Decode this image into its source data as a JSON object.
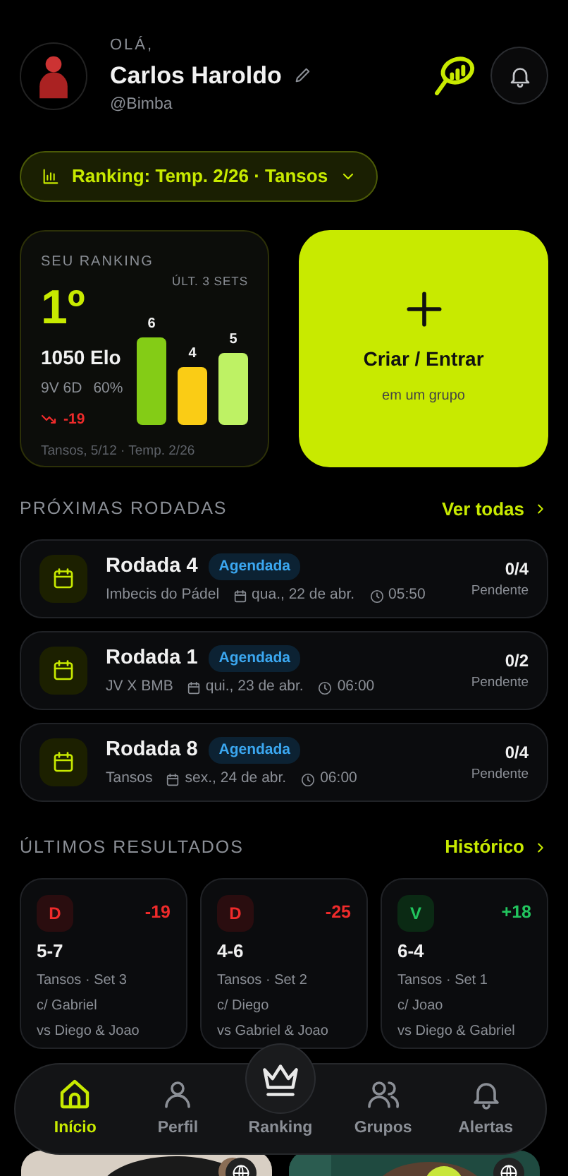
{
  "header": {
    "greeting": "OLÁ,",
    "name": "Carlos Haroldo",
    "handle": "@Bimba"
  },
  "ranking_filter": {
    "label": "Ranking: Temp. 2/26 · Tansos"
  },
  "ranking_card": {
    "title": "SEU RANKING",
    "sets_label": "ÚLT. 3 SETS",
    "position": "1º",
    "elo": "1050 Elo",
    "record": "9V 6D",
    "winrate": "60%",
    "trend": "-19",
    "footer": "Tansos, 5/12 · Temp. 2/26",
    "chart_data": {
      "type": "bar",
      "values": [
        6,
        4,
        5
      ],
      "colors": [
        "#84cc16",
        "#facc15",
        "#bef264"
      ],
      "data_labels": true
    }
  },
  "create_card": {
    "title": "Criar / Entrar",
    "subtitle": "em um grupo"
  },
  "upcoming": {
    "title": "PRÓXIMAS RODADAS",
    "link": "Ver todas",
    "rounds": [
      {
        "name": "Rodada 4",
        "status": "Agendada",
        "group": "Imbecis do Pádel",
        "date": "qua., 22 de abr.",
        "time": "05:50",
        "score": "0/4",
        "score_label": "Pendente"
      },
      {
        "name": "Rodada 1",
        "status": "Agendada",
        "group": "JV X BMB",
        "date": "qui., 23 de abr.",
        "time": "06:00",
        "score": "0/2",
        "score_label": "Pendente"
      },
      {
        "name": "Rodada 8",
        "status": "Agendada",
        "group": "Tansos",
        "date": "sex., 24 de abr.",
        "time": "06:00",
        "score": "0/4",
        "score_label": "Pendente"
      }
    ]
  },
  "results": {
    "title": "ÚLTIMOS RESULTADOS",
    "link": "Histórico",
    "items": [
      {
        "kind": "loss",
        "outcome": "D",
        "delta": "-19",
        "score": "5-7",
        "set": "Tansos · Set 3",
        "partner": "c/ Gabriel",
        "opponents": "vs Diego & Joao"
      },
      {
        "kind": "loss",
        "outcome": "D",
        "delta": "-25",
        "score": "4-6",
        "set": "Tansos · Set 2",
        "partner": "c/ Diego",
        "opponents": "vs Gabriel & Joao"
      },
      {
        "kind": "win",
        "outcome": "V",
        "delta": "+18",
        "score": "6-4",
        "set": "Tansos · Set 1",
        "partner": "c/ Joao",
        "opponents": "vs Diego & Gabriel"
      }
    ]
  },
  "nav": [
    {
      "label": "Início",
      "kind": "home",
      "selected": true
    },
    {
      "label": "Perfil",
      "kind": "person",
      "selected": false
    },
    {
      "label": "Ranking",
      "kind": "crown",
      "selected": false
    },
    {
      "label": "Grupos",
      "kind": "group",
      "selected": false
    },
    {
      "label": "Alertas",
      "kind": "bell",
      "selected": false
    }
  ]
}
